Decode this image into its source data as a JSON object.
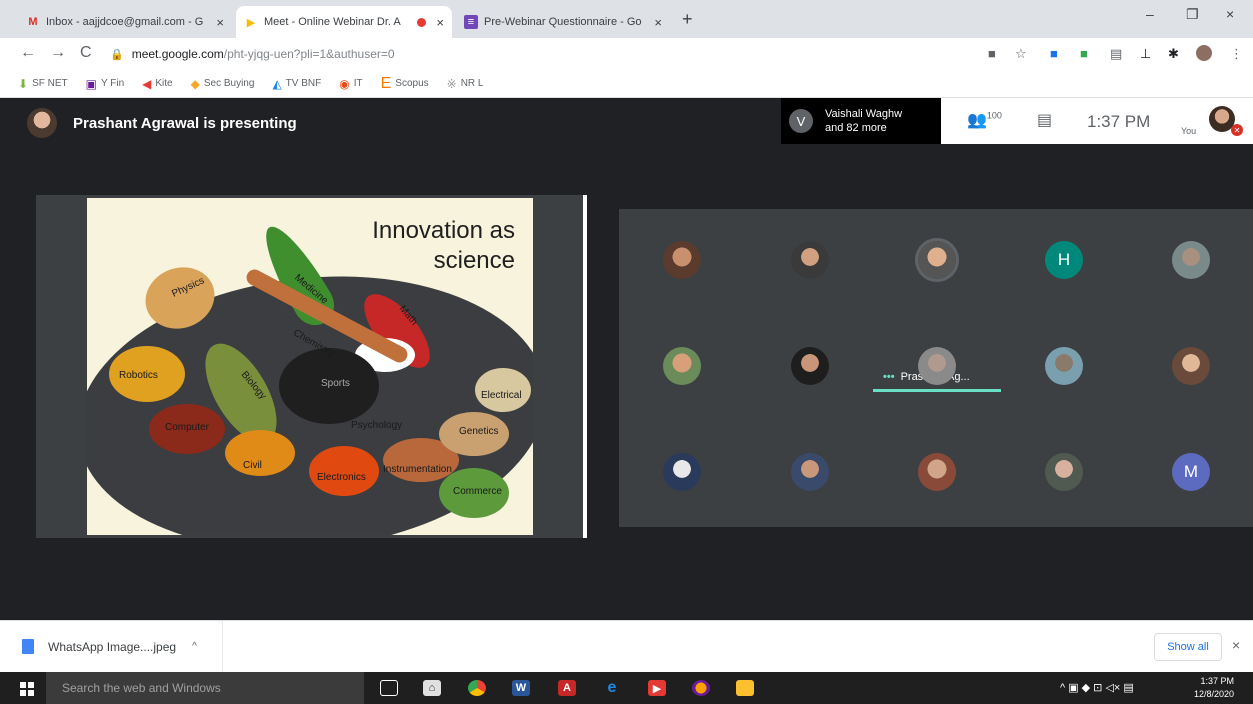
{
  "browser": {
    "tabs": [
      {
        "title": "Inbox - aajjdcoe@gmail.com - G",
        "icon": "gmail-icon",
        "close": "×"
      },
      {
        "title": "Meet - Online Webinar Dr. A",
        "icon": "meet-icon",
        "close": "×"
      },
      {
        "title": "Pre-Webinar Questionnaire - Go",
        "icon": "forms-icon",
        "close": "×"
      }
    ],
    "new_tab": "+",
    "window_controls": {
      "minimize": "–",
      "maximize": "❐",
      "close": "×"
    },
    "nav": {
      "back": "←",
      "forward": "→",
      "reload": "C"
    },
    "url_host": "meet.google.com",
    "url_path": "/pht-yjqg-uen?pli=1&authuser=0",
    "bookmarks": [
      {
        "label": "SF NET",
        "icon": "⬇",
        "color": "#7cb342"
      },
      {
        "label": "Y Fin",
        "icon": "▣",
        "color": "#6a1b9a"
      },
      {
        "label": "Kite",
        "icon": "◀",
        "color": "#e53935"
      },
      {
        "label": "Sec Buying",
        "icon": "◆",
        "color": "#f9a825"
      },
      {
        "label": "TV BNF",
        "icon": "◭",
        "color": "#1e88e5"
      },
      {
        "label": "IT",
        "icon": "◉",
        "color": "#e64a19"
      },
      {
        "label": "Scopus",
        "icon": "E",
        "color": "#f57c00"
      },
      {
        "label": "NR L",
        "icon": "※",
        "color": "#9e9e9e"
      }
    ]
  },
  "meet": {
    "presenting_text": "Prashant Agrawal is presenting",
    "people_pill": {
      "initial": "V",
      "line1": "Vaishali Waghw",
      "line2": "and 82 more"
    },
    "participant_count": "100",
    "time": "1:37 PM",
    "you_label": "You",
    "speaker_name": "Prashant Ag...",
    "speaker_dots": "•••",
    "letter_avatars": {
      "h": "H",
      "m": "M"
    }
  },
  "slide": {
    "title_line1": "Innovation as",
    "title_line2": "science",
    "labels": {
      "physics": "Physics",
      "medicine": "Medicine",
      "math": "Math",
      "chemistry": "Chemistry",
      "robotics": "Robotics",
      "biology": "Biology",
      "sports": "Sports",
      "electrical": "Electrical",
      "computer": "Computer",
      "psychology": "Psychology",
      "genetics": "Genetics",
      "civil": "Civil",
      "electronics": "Electronics",
      "instrumentation": "Instrumentation",
      "commerce": "Commerce"
    }
  },
  "downloads": {
    "file_name": "WhatsApp Image....jpeg",
    "chevron": "^",
    "show_all": "Show all",
    "close": "×"
  },
  "taskbar": {
    "search_placeholder": "Search the web and Windows",
    "clock_time": "1:37 PM",
    "clock_date": "12/8/2020"
  }
}
